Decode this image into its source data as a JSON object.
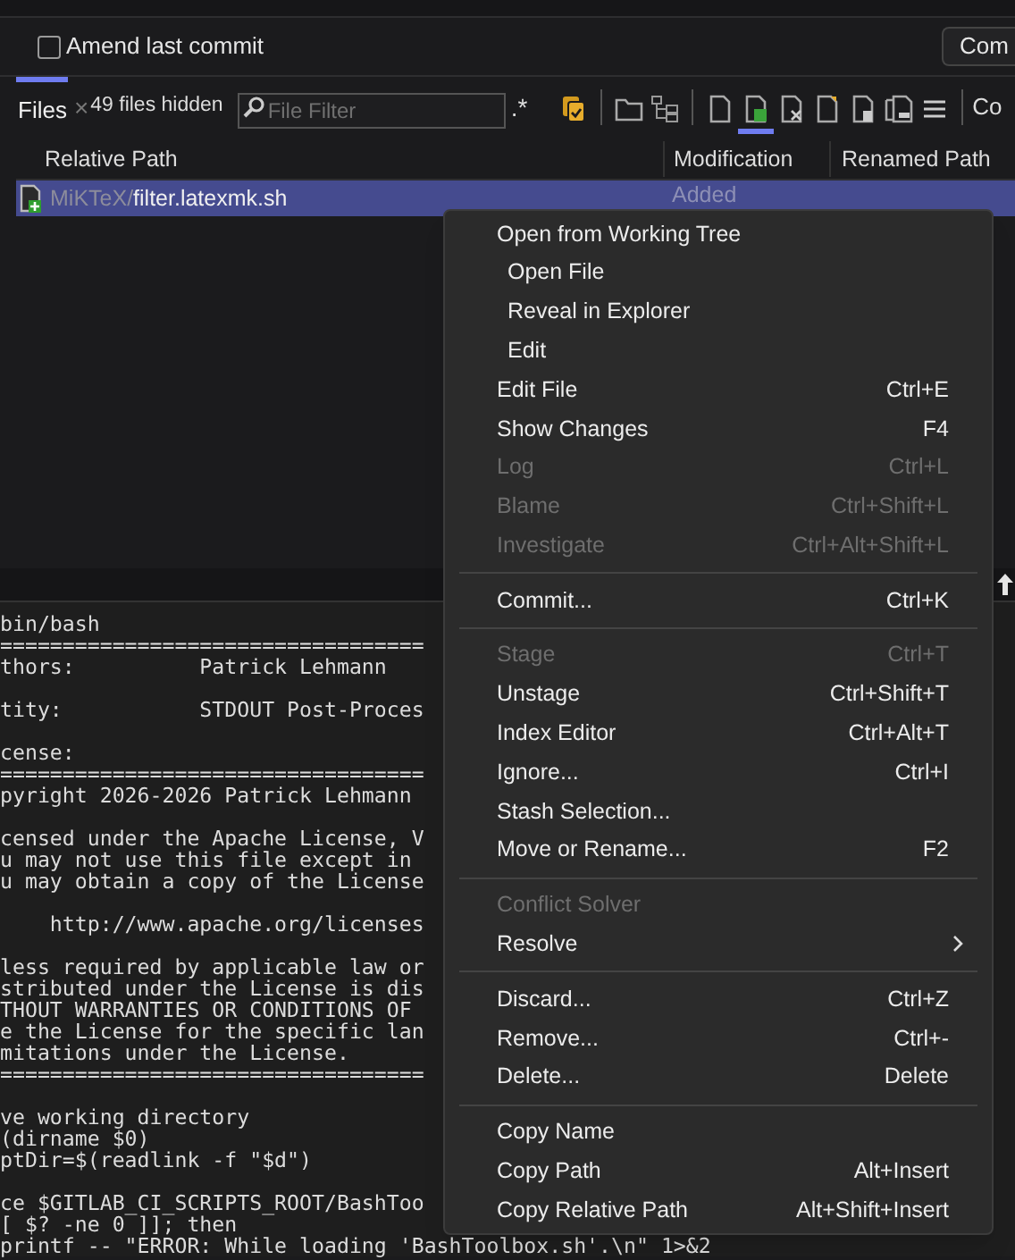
{
  "commit_panel": {
    "amend": {
      "label": "Amend last commit",
      "checked": false
    },
    "commit_button": "Com"
  },
  "tabs": [
    {
      "label": "Files",
      "selected": true
    }
  ],
  "files_toolbar": {
    "close": "×",
    "hidden_count": "49 files hidden",
    "filter": {
      "placeholder": "File Filter"
    },
    "regex": ".*",
    "buttons": [
      {
        "kind": "staged",
        "selected": false
      },
      {
        "kind": "separator"
      },
      {
        "kind": "folder",
        "selected": false
      },
      {
        "kind": "tree",
        "selected": false
      },
      {
        "kind": "separator"
      },
      {
        "kind": "file",
        "selected": false
      },
      {
        "kind": "added",
        "selected": true
      },
      {
        "kind": "deleted",
        "selected": false
      },
      {
        "kind": "new",
        "selected": false
      },
      {
        "kind": "modified",
        "selected": false
      },
      {
        "kind": "copied",
        "selected": false
      },
      {
        "kind": "menu",
        "selected": false
      },
      {
        "kind": "separator"
      }
    ],
    "overflow_label": "Co"
  },
  "table": {
    "columns": [
      "Relative Path",
      "Modification",
      "Renamed Path"
    ],
    "rows": [
      {
        "folder": "MiKTeX/",
        "file": "filter.latexmk.sh",
        "modification": "Added",
        "selected": true
      }
    ]
  },
  "editor": {
    "lines": [
      {
        "kind": "code",
        "text": "bin/bash"
      },
      {
        "kind": "code",
        "text": "=================================="
      },
      {
        "kind": "code",
        "text": "thors:          Patrick Lehmann"
      },
      {
        "kind": "blank"
      },
      {
        "kind": "code",
        "text": "tity:           STDOUT Post-Proces"
      },
      {
        "kind": "blank"
      },
      {
        "kind": "code",
        "text": "cense:"
      },
      {
        "kind": "code",
        "text": "=================================="
      },
      {
        "kind": "code",
        "text": "pyright 2026-2026 Patrick Lehmann"
      },
      {
        "kind": "blank"
      },
      {
        "kind": "code",
        "text": "censed under the Apache License, V"
      },
      {
        "kind": "code",
        "text": "u may not use this file except in"
      },
      {
        "kind": "code",
        "text": "u may obtain a copy of the License"
      },
      {
        "kind": "blank"
      },
      {
        "kind": "code",
        "text": "    http://www.apache.org/licenses"
      },
      {
        "kind": "blank"
      },
      {
        "kind": "code",
        "text": "less required by applicable law or"
      },
      {
        "kind": "code",
        "text": "stributed under the License is dis"
      },
      {
        "kind": "code",
        "text": "THOUT WARRANTIES OR CONDITIONS OF"
      },
      {
        "kind": "code",
        "text": "e the License for the specific lan"
      },
      {
        "kind": "code",
        "text": "mitations under the License."
      },
      {
        "kind": "code",
        "text": "=================================="
      },
      {
        "kind": "blank"
      },
      {
        "kind": "code",
        "text": "ve working directory"
      },
      {
        "kind": "code",
        "text": "(dirname $0)"
      },
      {
        "kind": "code",
        "text": "ptDir=$(readlink -f \"$d\")"
      },
      {
        "kind": "blank"
      },
      {
        "kind": "code",
        "text": "ce $GITLAB_CI_SCRIPTS_ROOT/BashToo"
      },
      {
        "kind": "code",
        "text": "[ $? -ne 0 ]]; then"
      },
      {
        "kind": "code",
        "text": "printf -- \"ERROR: While loading 'BashToolbox.sh'.\\n\" 1>&2"
      }
    ]
  },
  "context_menu": {
    "items": [
      {
        "kind": "item",
        "label": "Open from Working Tree",
        "disabled": false
      },
      {
        "kind": "sub",
        "label": "Open File",
        "disabled": false
      },
      {
        "kind": "sub",
        "label": "Reveal in Explorer",
        "disabled": false
      },
      {
        "kind": "sub",
        "label": "Edit",
        "disabled": false
      },
      {
        "kind": "item",
        "label": "Edit File",
        "shortcut": "Ctrl+E",
        "disabled": false
      },
      {
        "kind": "item",
        "label": "Show Changes",
        "shortcut": "F4",
        "disabled": false
      },
      {
        "kind": "item",
        "label": "Log",
        "shortcut": "Ctrl+L",
        "disabled": true
      },
      {
        "kind": "item",
        "label": "Blame",
        "shortcut": "Ctrl+Shift+L",
        "disabled": true
      },
      {
        "kind": "item",
        "label": "Investigate",
        "shortcut": "Ctrl+Alt+Shift+L",
        "disabled": true
      },
      {
        "kind": "separator"
      },
      {
        "kind": "item",
        "label": "Commit...",
        "shortcut": "Ctrl+K",
        "disabled": false
      },
      {
        "kind": "separator"
      },
      {
        "kind": "item",
        "label": "Stage",
        "shortcut": "Ctrl+T",
        "disabled": true
      },
      {
        "kind": "item",
        "label": "Unstage",
        "shortcut": "Ctrl+Shift+T",
        "disabled": false
      },
      {
        "kind": "item",
        "label": "Index Editor",
        "shortcut": "Ctrl+Alt+T",
        "disabled": false
      },
      {
        "kind": "item",
        "label": "Ignore...",
        "shortcut": "Ctrl+I",
        "disabled": false
      },
      {
        "kind": "item",
        "label": "Stash Selection...",
        "disabled": false
      },
      {
        "kind": "item",
        "label": "Move or Rename...",
        "shortcut": "F2",
        "disabled": false
      },
      {
        "kind": "separator"
      },
      {
        "kind": "item",
        "label": "Conflict Solver",
        "disabled": true
      },
      {
        "kind": "submenu",
        "label": "Resolve",
        "disabled": false
      },
      {
        "kind": "separator"
      },
      {
        "kind": "item",
        "label": "Discard...",
        "shortcut": "Ctrl+Z",
        "disabled": false
      },
      {
        "kind": "item",
        "label": "Remove...",
        "shortcut": "Ctrl+-",
        "disabled": false
      },
      {
        "kind": "item",
        "label": "Delete...",
        "shortcut": "Delete",
        "disabled": false
      },
      {
        "kind": "separator"
      },
      {
        "kind": "item",
        "label": "Copy Name",
        "disabled": false
      },
      {
        "kind": "item",
        "label": "Copy Path",
        "shortcut": "Alt+Insert",
        "disabled": false
      },
      {
        "kind": "item",
        "label": "Copy Relative Path",
        "shortcut": "Alt+Shift+Insert",
        "disabled": false
      }
    ]
  }
}
